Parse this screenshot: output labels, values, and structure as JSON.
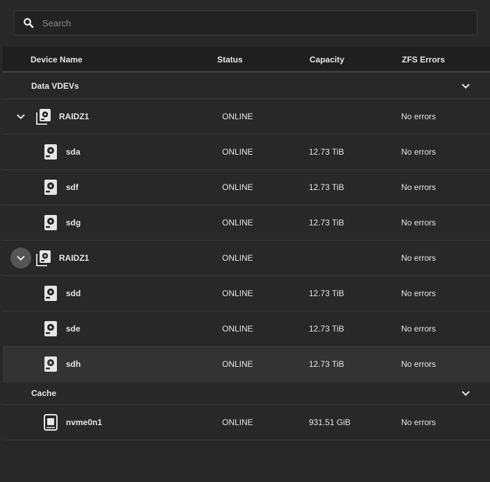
{
  "search": {
    "placeholder": "Search",
    "value": ""
  },
  "columns": {
    "device_name": "Device Name",
    "status": "Status",
    "capacity": "Capacity",
    "zfs_errors": "ZFS Errors"
  },
  "groups": [
    {
      "label": "Data VDEVs",
      "vdevs": [
        {
          "name": "RAIDZ1",
          "status": "ONLINE",
          "capacity": "",
          "errors": "No errors",
          "disks": [
            {
              "name": "sda",
              "status": "ONLINE",
              "capacity": "12.73 TiB",
              "errors": "No errors"
            },
            {
              "name": "sdf",
              "status": "ONLINE",
              "capacity": "12.73 TiB",
              "errors": "No errors"
            },
            {
              "name": "sdg",
              "status": "ONLINE",
              "capacity": "12.73 TiB",
              "errors": "No errors"
            }
          ]
        },
        {
          "name": "RAIDZ1",
          "status": "ONLINE",
          "capacity": "",
          "errors": "No errors",
          "disks": [
            {
              "name": "sdd",
              "status": "ONLINE",
              "capacity": "12.73 TiB",
              "errors": "No errors"
            },
            {
              "name": "sde",
              "status": "ONLINE",
              "capacity": "12.73 TiB",
              "errors": "No errors"
            },
            {
              "name": "sdh",
              "status": "ONLINE",
              "capacity": "12.73 TiB",
              "errors": "No errors"
            }
          ]
        }
      ]
    },
    {
      "label": "Cache",
      "devices": [
        {
          "name": "nvme0n1",
          "status": "ONLINE",
          "capacity": "931.51 GiB",
          "errors": "No errors"
        }
      ]
    }
  ]
}
